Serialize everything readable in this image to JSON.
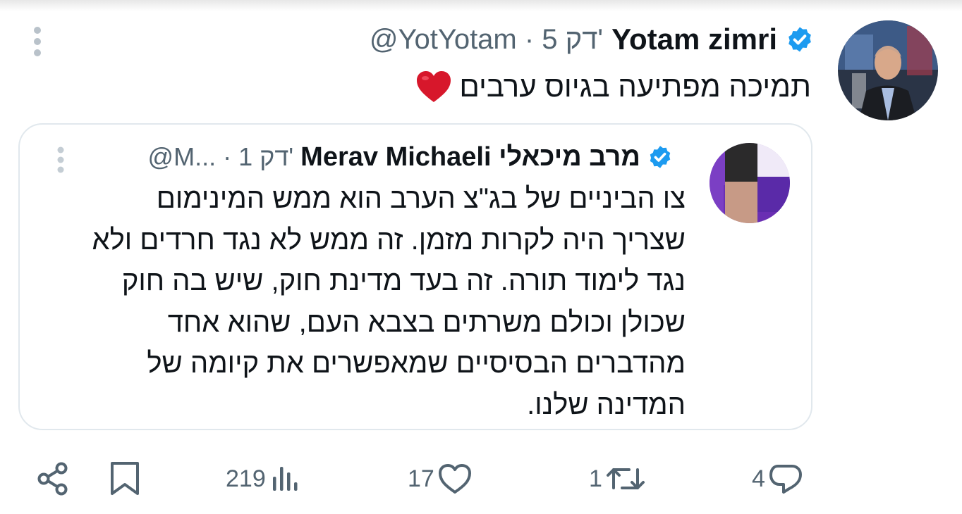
{
  "tweet": {
    "author_name": "Yotam zimri",
    "handle_time": "@YotYotam · 5 דק'",
    "text": "תמיכה מפתיעה בגיוס ערבים"
  },
  "quote": {
    "author_name": "Merav Michaeli מרב מיכאלי",
    "handle_time": "@M... · 1 דק'",
    "lines": [
      "צו הביניים של בג\"צ הערב הוא ממש המינימום",
      "שצריך היה לקרות מזמן. זה ממש לא נגד חרדים ולא",
      "נגד לימוד תורה. זה בעד מדינת חוק, שיש בה חוק",
      "שכולן וכולם משרתים בצבא העם, שהוא אחד",
      "מהדברים הבסיסיים שמאפשרים את קיומה של",
      "המדינה שלנו."
    ]
  },
  "actions": {
    "views": "219",
    "likes": "17",
    "retweets": "1",
    "replies": "4"
  },
  "icons": {
    "verified": "verified-badge-icon",
    "menu": "more-vertical-icon",
    "heart_emoji": "red-heart-icon",
    "share": "share-icon",
    "bookmark": "bookmark-icon",
    "views": "views-icon",
    "like": "heart-icon",
    "retweet": "retweet-icon",
    "reply": "reply-icon"
  },
  "colors": {
    "verified_blue": "#1d9bf0",
    "secondary_text": "#536471",
    "heart_red": "#d7172b"
  }
}
